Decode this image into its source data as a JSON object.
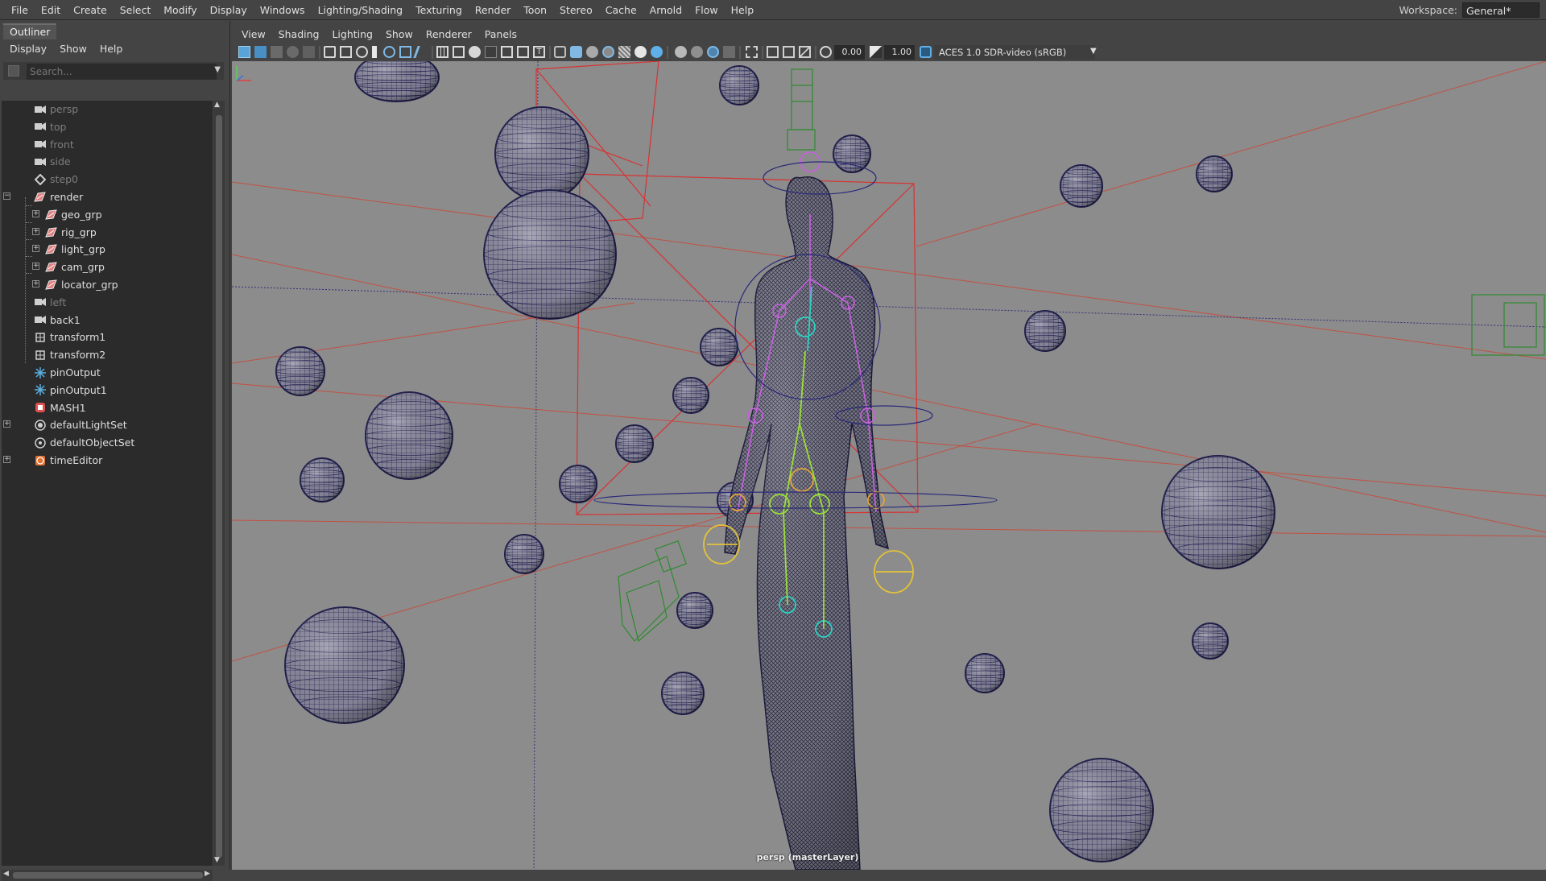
{
  "menubar": {
    "items": [
      "File",
      "Edit",
      "Create",
      "Select",
      "Modify",
      "Display",
      "Windows",
      "Lighting/Shading",
      "Texturing",
      "Render",
      "Toon",
      "Stereo",
      "Cache",
      "Arnold",
      "Flow",
      "Help"
    ],
    "workspace_label": "Workspace:",
    "workspace_value": "General*"
  },
  "outliner": {
    "title": "Outliner",
    "menu": [
      "Display",
      "Show",
      "Help"
    ],
    "search_placeholder": "Search...",
    "items": [
      {
        "name": "persp",
        "icon": "camera-icon",
        "dim": true
      },
      {
        "name": "top",
        "icon": "camera-icon",
        "dim": true
      },
      {
        "name": "front",
        "icon": "camera-icon",
        "dim": true
      },
      {
        "name": "side",
        "icon": "camera-icon",
        "dim": true
      },
      {
        "name": "step0",
        "icon": "transform-icon",
        "dim": true
      },
      {
        "name": "render",
        "icon": "group-icon",
        "dim": false
      },
      {
        "name": "geo_grp",
        "icon": "group-icon",
        "dim": false
      },
      {
        "name": "rig_grp",
        "icon": "group-icon",
        "dim": false
      },
      {
        "name": "light_grp",
        "icon": "group-icon",
        "dim": false
      },
      {
        "name": "cam_grp",
        "icon": "group-icon",
        "dim": false
      },
      {
        "name": "locator_grp",
        "icon": "group-icon",
        "dim": false
      },
      {
        "name": "left",
        "icon": "camera-icon",
        "dim": true
      },
      {
        "name": "back1",
        "icon": "camera-icon",
        "dim": false
      },
      {
        "name": "transform1",
        "icon": "mesh-transform-icon",
        "dim": false
      },
      {
        "name": "transform2",
        "icon": "mesh-transform-icon",
        "dim": false
      },
      {
        "name": "pinOutput",
        "icon": "pin-icon",
        "dim": false
      },
      {
        "name": "pinOutput1",
        "icon": "pin-icon",
        "dim": false
      },
      {
        "name": "MASH1",
        "icon": "mash-icon",
        "dim": false
      },
      {
        "name": "defaultLightSet",
        "icon": "light-set-icon",
        "dim": false
      },
      {
        "name": "defaultObjectSet",
        "icon": "object-set-icon",
        "dim": false
      },
      {
        "name": "timeEditor",
        "icon": "time-editor-icon",
        "dim": false
      }
    ]
  },
  "viewport": {
    "menu": [
      "View",
      "Shading",
      "Lighting",
      "Show",
      "Renderer",
      "Panels"
    ],
    "exposure": "0.00",
    "gamma": "1.00",
    "color_space": "ACES 1.0 SDR-video (sRGB)",
    "camera_label": "persp (masterLayer)"
  },
  "colors": {
    "viewport_bg": "#8c8c8c",
    "mesh_wire": "#1e1d4a",
    "selection_red": "#d83232",
    "camera_green": "#2f8a2f",
    "joint_magenta": "#c860e0",
    "joint_yellow": "#e2c23a"
  }
}
